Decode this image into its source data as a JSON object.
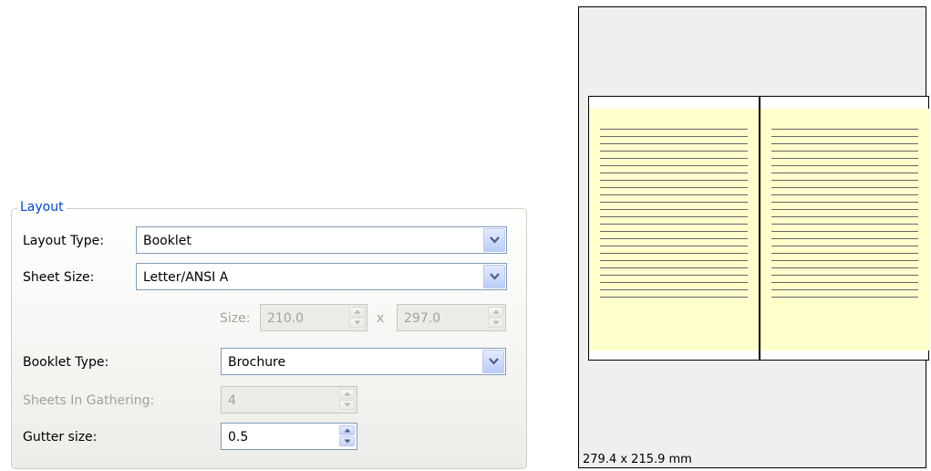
{
  "layout_group": {
    "title": "Layout",
    "layout_type": {
      "label": "Layout Type:",
      "value": "Booklet"
    },
    "sheet_size": {
      "label": "Sheet Size:",
      "value": "Letter/ANSI A"
    },
    "size": {
      "label": "Size:",
      "width": "210.0",
      "separator": "x",
      "height": "297.0"
    },
    "booklet_type": {
      "label": "Booklet Type:",
      "value": "Brochure"
    },
    "sheets_in_gathering": {
      "label": "Sheets In Gathering:",
      "value": "4"
    },
    "gutter_size": {
      "label": "Gutter size:",
      "value": "0.5"
    }
  },
  "preview": {
    "dimensions": "279.4 x 215.9 mm",
    "page_color": "#ffffcc",
    "lines_per_page": 24
  }
}
